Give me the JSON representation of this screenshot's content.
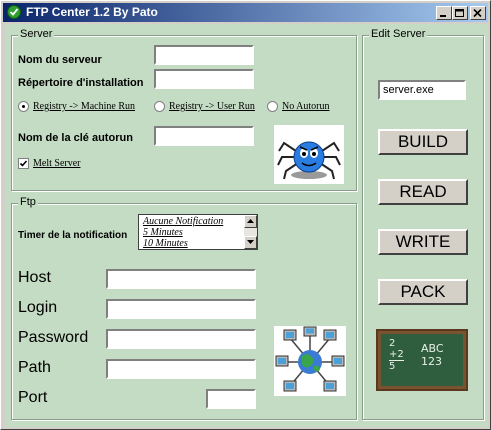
{
  "window": {
    "title": "FTP Center 1.2 By Pato"
  },
  "server_group": {
    "label": "Server",
    "server_name_label": "Nom du serveur",
    "server_name_value": "",
    "install_dir_label": "Répertoire d'installation",
    "install_dir_value": "",
    "radios": [
      {
        "label": "Registry -> Machine Run",
        "selected": true
      },
      {
        "label": "Registry -> User Run",
        "selected": false
      },
      {
        "label": "No Autorun",
        "selected": false
      }
    ],
    "autorun_key_label": "Nom de la clé autorun",
    "autorun_key_value": "",
    "melt_label": "Melt Server",
    "melt_checked": true
  },
  "ftp_group": {
    "label": "Ftp",
    "timer_label": "Timer de la notification",
    "timer_options": [
      "Aucune Notification",
      "5 Minutes",
      "10 Minutes"
    ],
    "host_label": "Host",
    "host_value": "",
    "login_label": "Login",
    "login_value": "",
    "password_label": "Password",
    "password_value": "",
    "path_label": "Path",
    "path_value": "",
    "port_label": "Port",
    "port_value": ""
  },
  "edit_group": {
    "label": "Edit Server",
    "file_value": "server.exe",
    "build_label": "BUILD",
    "read_label": "READ",
    "write_label": "WRITE",
    "pack_label": "PACK"
  },
  "icons": {
    "title": "check-icon",
    "spider": "spider-icon",
    "network": "network-icon",
    "chalkboard": "chalkboard-icon"
  },
  "chalkboard": {
    "math_lines": [
      "2",
      "+2",
      "5"
    ],
    "abc_lines": [
      "ABC",
      "123"
    ]
  },
  "colors": {
    "client_bg": "#c4dcc4",
    "titlebar_start": "#0a246a",
    "titlebar_end": "#a6caf0"
  }
}
